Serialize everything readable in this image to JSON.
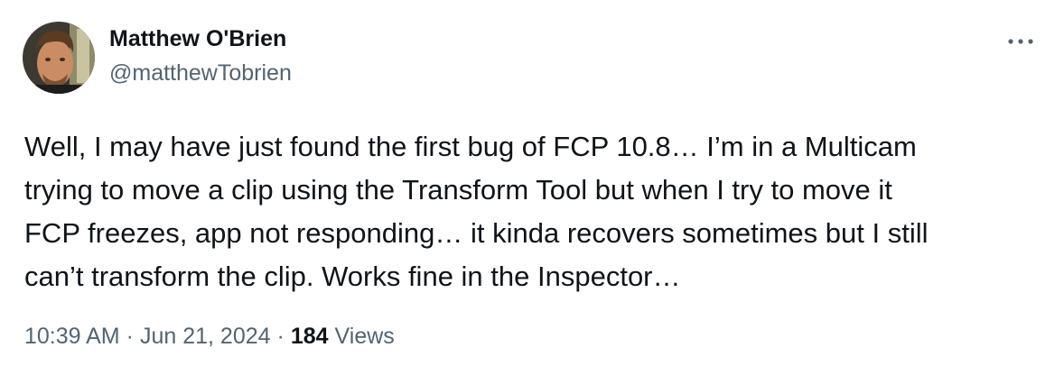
{
  "author": {
    "display_name": "Matthew O'Brien",
    "handle": "@matthewTobrien",
    "avatar_icon": "avatar-photo"
  },
  "tweet": {
    "text_lines": [
      "Well, I may have just found the first bug of FCP 10.8… I’m in a Multicam",
      "trying to move a clip using the Transform Tool but when I try to move it",
      "FCP freezes, app not responding… it kinda recovers sometimes but I still",
      "can’t transform the clip. Works fine in the Inspector…"
    ]
  },
  "meta": {
    "time": "10:39 AM",
    "separator": "·",
    "date": "Jun 21, 2024",
    "views_count": "184",
    "views_label": "Views"
  },
  "more_icon": "more-horizontal-icon",
  "colors": {
    "text_primary": "#0f1419",
    "text_secondary": "#536471",
    "background": "#ffffff"
  }
}
